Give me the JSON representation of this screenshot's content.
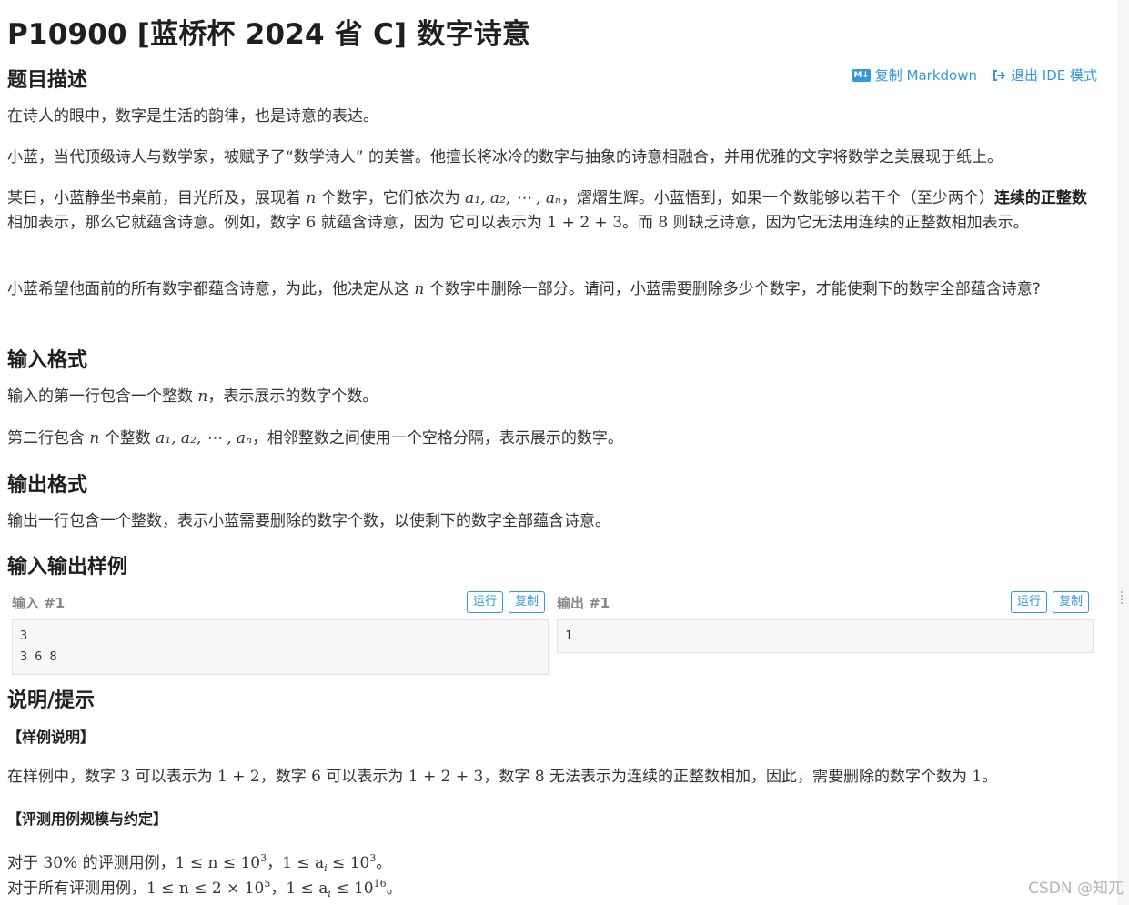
{
  "problem": {
    "title": "P10900 [蓝桥杯 2024 省 C] 数字诗意"
  },
  "toolbar": {
    "copy_markdown": "复制 Markdown",
    "exit_ide": "退出 IDE 模式",
    "md_icon_text": "M↓"
  },
  "sections": {
    "description": "题目描述",
    "input_format": "输入格式",
    "output_format": "输出格式",
    "samples": "输入输出样例",
    "hint": "说明/提示"
  },
  "description": {
    "p1": "在诗人的眼中，数字是生活的韵律，也是诗意的表达。",
    "p2": "小蓝，当代顶级诗人与数学家，被赋予了“数学诗人” 的美誉。他擅长将冰冷的数字与抽象的诗意相融合，并用优雅的文字将数学之美展现于纸上。",
    "p3_a": "某日，小蓝静坐书桌前，目光所及，展现着 ",
    "p3_n": "n",
    "p3_b": " 个数字，它们依次为 ",
    "p3_seq": "a₁, a₂, ⋯ , aₙ",
    "p3_c": "，熠熠生辉。小蓝悟到，如果一个数能够以若干个（至少两个）",
    "p3_bold": "连续的正整数",
    "p3_d": "相加表示，那么它就蕴含诗意。例如，数字 ",
    "p3_six": "6",
    "p3_e": " 就蕴含诗意，因为 它可以表示为 ",
    "p3_sum": "1 + 2 + 3",
    "p3_f": "。而 ",
    "p3_eight": "8",
    "p3_g": " 则缺乏诗意，因为它无法用连续的正整数相加表示。",
    "p4_a": "小蓝希望他面前的所有数字都蕴含诗意，为此，他决定从这 ",
    "p4_n": "n",
    "p4_b": " 个数字中删除一部分。请问，小蓝需要删除多少个数字，才能使剩下的数字全部蕴含诗意?"
  },
  "input_format": {
    "l1_a": "输入的第一行包含一个整数 ",
    "l1_n": "n",
    "l1_b": "，表示展示的数字个数。",
    "l2_a": "第二行包含 ",
    "l2_n": "n",
    "l2_b": " 个整数 ",
    "l2_seq": "a₁, a₂, ⋯ , aₙ",
    "l2_c": "，相邻整数之间使用一个空格分隔，表示展示的数字。"
  },
  "output_format": {
    "l1": "输出一行包含一个整数，表示小蓝需要删除的数字个数，以使剩下的数字全部蕴含诗意。"
  },
  "samples": {
    "input_label": "输入 #1",
    "output_label": "输出 #1",
    "run": "运行",
    "copy": "复制",
    "input_text": "3\n3 6 8",
    "output_text": "1"
  },
  "hint": {
    "sample_explain_title": "【样例说明】",
    "explain_a": "在样例中，数字 ",
    "explain_3": "3",
    "explain_b": " 可以表示为 ",
    "explain_12": "1 + 2",
    "explain_c": "，数字 ",
    "explain_6": "6",
    "explain_d": " 可以表示为 ",
    "explain_123": "1 + 2 + 3",
    "explain_e": "，数字 ",
    "explain_8": "8",
    "explain_f": " 无法表示为连续的正整数相加，因此，需要删除的数字个数为 ",
    "explain_1": "1",
    "explain_g": "。",
    "scale_title": "【评测用例规模与约定】",
    "scale1_a": "对于 ",
    "scale1_pct": "30%",
    "scale1_b": " 的评测用例，",
    "scale1_n": "1 ≤ n ≤ 10",
    "scale1_nexp": "3",
    "scale1_sep": "，",
    "scale1_a_i": "1 ≤ a",
    "scale1_i": "i",
    "scale1_a_rest": " ≤ 10",
    "scale1_aexp": "3",
    "scale1_end": "。",
    "scale2_a": "对于所有评测用例，",
    "scale2_n": "1 ≤ n ≤ 2 × 10",
    "scale2_nexp": "5",
    "scale2_sep": "，",
    "scale2_a_i": "1 ≤ a",
    "scale2_i": "i",
    "scale2_a_rest": " ≤ 10",
    "scale2_aexp": "16",
    "scale2_end": "。"
  },
  "watermark": "CSDN @知兀",
  "colors": {
    "accent": "#3498db",
    "code_bg": "#f7f7f7"
  }
}
